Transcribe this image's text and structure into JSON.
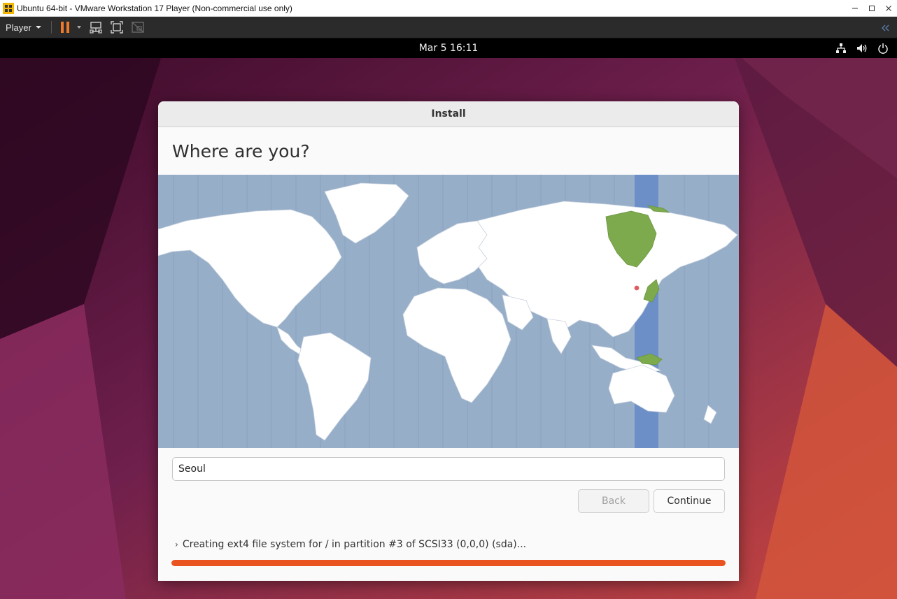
{
  "vmware": {
    "title": "Ubuntu 64-bit - VMware Workstation 17 Player (Non-commercial use only)",
    "player_menu": "Player",
    "window_buttons": [
      "minimize-icon",
      "maximize-icon",
      "close-icon"
    ],
    "toolbar_icons": [
      "pause-icon",
      "send-ctrl-alt-del-icon",
      "fullscreen-icon",
      "unity-icon",
      "collapse-toolbar-icon"
    ]
  },
  "guest": {
    "clock": "Mar 5  16:11",
    "tray_icons": [
      "network-icon",
      "volume-icon",
      "power-icon"
    ]
  },
  "installer": {
    "window_title": "Install",
    "heading": "Where are you?",
    "location_value": "Seoul",
    "back_label": "Back",
    "continue_label": "Continue",
    "status_text": "Creating ext4 file system for / in partition #3 of SCSI33 (0,0,0) (sda)...",
    "progress_percent": 100
  },
  "colors": {
    "accent": "#e95420",
    "map_ocean": "#97aec9",
    "map_land": "#ffffff",
    "timezone_highlight": "#7daa4d",
    "timezone_band": "#6c8fc8"
  }
}
